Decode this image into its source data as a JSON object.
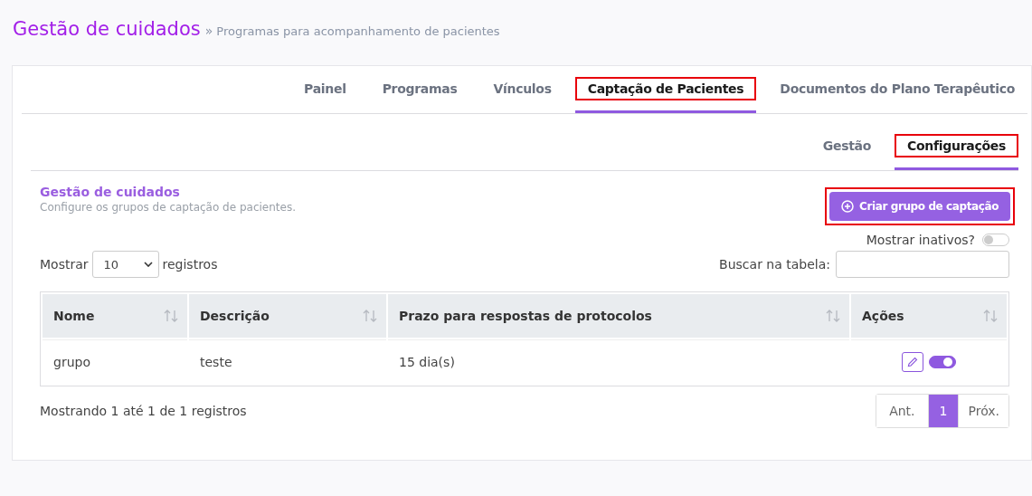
{
  "header": {
    "title": "Gestão de cuidados",
    "separator": "»",
    "subtitle": "Programas para acompanhamento de pacientes"
  },
  "tabs": [
    {
      "label": "Painel",
      "selected": false,
      "highlighted": false
    },
    {
      "label": "Programas",
      "selected": false,
      "highlighted": false
    },
    {
      "label": "Vínculos",
      "selected": false,
      "highlighted": false
    },
    {
      "label": "Captação de Pacientes",
      "selected": true,
      "highlighted": true
    },
    {
      "label": "Documentos do Plano Terapêutico",
      "selected": false,
      "highlighted": false
    }
  ],
  "subtabs": [
    {
      "label": "Gestão",
      "selected": false,
      "highlighted": false
    },
    {
      "label": "Configurações",
      "selected": true,
      "highlighted": true
    }
  ],
  "section": {
    "title": "Gestão de cuidados",
    "description": "Configure os grupos de captação de pacientes."
  },
  "create_button": {
    "label": "Criar grupo de captação",
    "highlighted": true
  },
  "show_inactive": {
    "label": "Mostrar inativos?",
    "on": false
  },
  "length": {
    "before": "Mostrar",
    "value": "10",
    "after": "registros"
  },
  "search": {
    "label": "Buscar na tabela:"
  },
  "table": {
    "columns": [
      "Nome",
      "Descrição",
      "Prazo para respostas de protocolos",
      "Ações"
    ],
    "rows": [
      {
        "cells": [
          "grupo",
          "teste",
          "15 dia(s)"
        ],
        "active": true
      }
    ]
  },
  "info": "Mostrando 1 até 1 de 1 registros",
  "pagination": [
    {
      "label": "Ant.",
      "selected": false
    },
    {
      "label": "1",
      "selected": true
    },
    {
      "label": "Próx.",
      "selected": false
    }
  ]
}
